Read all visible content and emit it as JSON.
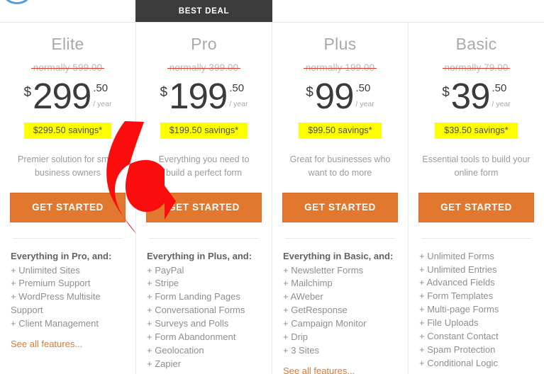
{
  "banner": {
    "best_deal_label": "BEST DEAL"
  },
  "currency_symbol": "$",
  "period_label": "/ year",
  "cta_label": "GET STARTED",
  "see_all_label": "See all features...",
  "plans": [
    {
      "name": "Elite",
      "normally": "normally 599.00",
      "amount": "299",
      "cents": ".50",
      "savings": "$299.50 savings*",
      "description": "Premier solution for small business owners",
      "features_head": "Everything in Pro, and:",
      "features": [
        "+ Unlimited Sites",
        "+ Premium Support",
        "+ WordPress Multisite Support",
        "+ Client Management"
      ],
      "has_see_all": true
    },
    {
      "name": "Pro",
      "normally": "normally 399.00",
      "amount": "199",
      "cents": ".50",
      "savings": "$199.50 savings*",
      "description": "Everything you need to build a perfect form",
      "features_head": "Everything in Plus, and:",
      "features": [
        "+ PayPal",
        "+ Stripe",
        "+ Form Landing Pages",
        "+ Conversational Forms",
        "+ Surveys and Polls",
        "+ Form Abandonment",
        "+ Geolocation",
        "+ Zapier"
      ],
      "has_see_all": false
    },
    {
      "name": "Plus",
      "normally": "normally 199.00",
      "amount": "99",
      "cents": ".50",
      "savings": "$99.50 savings*",
      "description": "Great for businesses who want to do more",
      "features_head": "Everything in Basic, and:",
      "features": [
        "+ Newsletter Forms",
        "+ Mailchimp",
        "+ AWeber",
        "+ GetResponse",
        "+ Campaign Monitor",
        "+ Drip",
        "+ 3 Sites"
      ],
      "has_see_all": true
    },
    {
      "name": "Basic",
      "normally": "normally 79.00",
      "amount": "39",
      "cents": ".50",
      "savings": "$39.50 savings*",
      "description": "Essential tools to build your online form",
      "features_head": "",
      "features": [
        "+ Unlimited Forms",
        "+ Unlimited Entries",
        "+ Advanced Fields",
        "+ Form Templates",
        "+ Multi-page Forms",
        "+ File Uploads",
        "+ Constant Contact",
        "+ Spam Protection",
        "+ Conditional Logic"
      ],
      "has_see_all": false
    }
  ],
  "colors": {
    "accent_orange": "#e2782f",
    "highlight_yellow": "#ffff00",
    "strike_red": "#e03a26",
    "banner_dark": "#3b3b3b",
    "arrow_red": "#fc0d0d"
  }
}
